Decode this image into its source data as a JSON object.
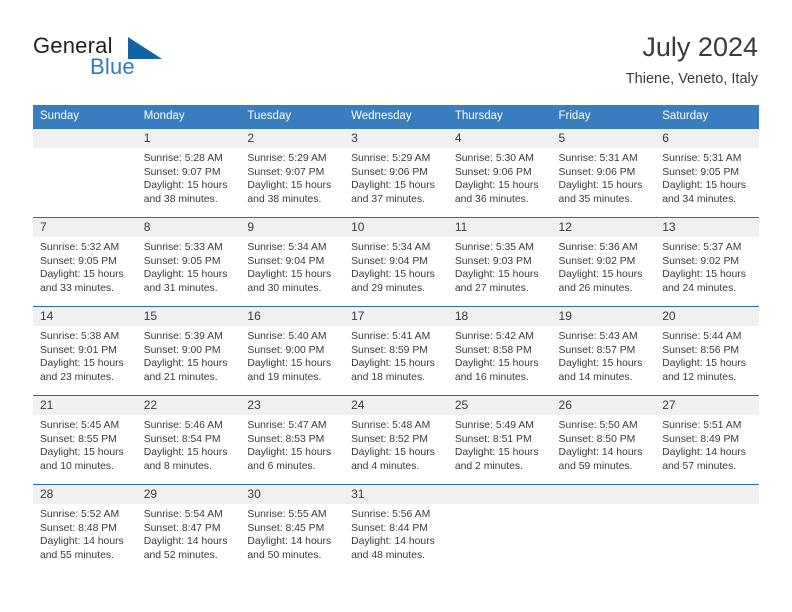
{
  "brand": {
    "word1": "General",
    "word2": "Blue",
    "mark": "triangle-logo"
  },
  "header": {
    "title": "July 2024",
    "subtitle": "Thiene, Veneto, Italy"
  },
  "colors": {
    "header_blue": "#3a7dbf",
    "rule_blue": "#2e6da4",
    "brand_blue": "#2b7cc2",
    "daynum_band": "#f0f0f0",
    "text": "#3b3b3b"
  },
  "weekday_headers": [
    "Sunday",
    "Monday",
    "Tuesday",
    "Wednesday",
    "Thursday",
    "Friday",
    "Saturday"
  ],
  "labels": {
    "sunrise": "Sunrise:",
    "sunset": "Sunset:",
    "daylight": "Daylight:"
  },
  "weeks": [
    [
      {
        "day": ""
      },
      {
        "day": "1",
        "sunrise": "Sunrise: 5:28 AM",
        "sunset": "Sunset: 9:07 PM",
        "daylight1": "Daylight: 15 hours",
        "daylight2": "and 38 minutes."
      },
      {
        "day": "2",
        "sunrise": "Sunrise: 5:29 AM",
        "sunset": "Sunset: 9:07 PM",
        "daylight1": "Daylight: 15 hours",
        "daylight2": "and 38 minutes."
      },
      {
        "day": "3",
        "sunrise": "Sunrise: 5:29 AM",
        "sunset": "Sunset: 9:06 PM",
        "daylight1": "Daylight: 15 hours",
        "daylight2": "and 37 minutes."
      },
      {
        "day": "4",
        "sunrise": "Sunrise: 5:30 AM",
        "sunset": "Sunset: 9:06 PM",
        "daylight1": "Daylight: 15 hours",
        "daylight2": "and 36 minutes."
      },
      {
        "day": "5",
        "sunrise": "Sunrise: 5:31 AM",
        "sunset": "Sunset: 9:06 PM",
        "daylight1": "Daylight: 15 hours",
        "daylight2": "and 35 minutes."
      },
      {
        "day": "6",
        "sunrise": "Sunrise: 5:31 AM",
        "sunset": "Sunset: 9:05 PM",
        "daylight1": "Daylight: 15 hours",
        "daylight2": "and 34 minutes."
      }
    ],
    [
      {
        "day": "7",
        "sunrise": "Sunrise: 5:32 AM",
        "sunset": "Sunset: 9:05 PM",
        "daylight1": "Daylight: 15 hours",
        "daylight2": "and 33 minutes."
      },
      {
        "day": "8",
        "sunrise": "Sunrise: 5:33 AM",
        "sunset": "Sunset: 9:05 PM",
        "daylight1": "Daylight: 15 hours",
        "daylight2": "and 31 minutes."
      },
      {
        "day": "9",
        "sunrise": "Sunrise: 5:34 AM",
        "sunset": "Sunset: 9:04 PM",
        "daylight1": "Daylight: 15 hours",
        "daylight2": "and 30 minutes."
      },
      {
        "day": "10",
        "sunrise": "Sunrise: 5:34 AM",
        "sunset": "Sunset: 9:04 PM",
        "daylight1": "Daylight: 15 hours",
        "daylight2": "and 29 minutes."
      },
      {
        "day": "11",
        "sunrise": "Sunrise: 5:35 AM",
        "sunset": "Sunset: 9:03 PM",
        "daylight1": "Daylight: 15 hours",
        "daylight2": "and 27 minutes."
      },
      {
        "day": "12",
        "sunrise": "Sunrise: 5:36 AM",
        "sunset": "Sunset: 9:02 PM",
        "daylight1": "Daylight: 15 hours",
        "daylight2": "and 26 minutes."
      },
      {
        "day": "13",
        "sunrise": "Sunrise: 5:37 AM",
        "sunset": "Sunset: 9:02 PM",
        "daylight1": "Daylight: 15 hours",
        "daylight2": "and 24 minutes."
      }
    ],
    [
      {
        "day": "14",
        "sunrise": "Sunrise: 5:38 AM",
        "sunset": "Sunset: 9:01 PM",
        "daylight1": "Daylight: 15 hours",
        "daylight2": "and 23 minutes."
      },
      {
        "day": "15",
        "sunrise": "Sunrise: 5:39 AM",
        "sunset": "Sunset: 9:00 PM",
        "daylight1": "Daylight: 15 hours",
        "daylight2": "and 21 minutes."
      },
      {
        "day": "16",
        "sunrise": "Sunrise: 5:40 AM",
        "sunset": "Sunset: 9:00 PM",
        "daylight1": "Daylight: 15 hours",
        "daylight2": "and 19 minutes."
      },
      {
        "day": "17",
        "sunrise": "Sunrise: 5:41 AM",
        "sunset": "Sunset: 8:59 PM",
        "daylight1": "Daylight: 15 hours",
        "daylight2": "and 18 minutes."
      },
      {
        "day": "18",
        "sunrise": "Sunrise: 5:42 AM",
        "sunset": "Sunset: 8:58 PM",
        "daylight1": "Daylight: 15 hours",
        "daylight2": "and 16 minutes."
      },
      {
        "day": "19",
        "sunrise": "Sunrise: 5:43 AM",
        "sunset": "Sunset: 8:57 PM",
        "daylight1": "Daylight: 15 hours",
        "daylight2": "and 14 minutes."
      },
      {
        "day": "20",
        "sunrise": "Sunrise: 5:44 AM",
        "sunset": "Sunset: 8:56 PM",
        "daylight1": "Daylight: 15 hours",
        "daylight2": "and 12 minutes."
      }
    ],
    [
      {
        "day": "21",
        "sunrise": "Sunrise: 5:45 AM",
        "sunset": "Sunset: 8:55 PM",
        "daylight1": "Daylight: 15 hours",
        "daylight2": "and 10 minutes."
      },
      {
        "day": "22",
        "sunrise": "Sunrise: 5:46 AM",
        "sunset": "Sunset: 8:54 PM",
        "daylight1": "Daylight: 15 hours",
        "daylight2": "and 8 minutes."
      },
      {
        "day": "23",
        "sunrise": "Sunrise: 5:47 AM",
        "sunset": "Sunset: 8:53 PM",
        "daylight1": "Daylight: 15 hours",
        "daylight2": "and 6 minutes."
      },
      {
        "day": "24",
        "sunrise": "Sunrise: 5:48 AM",
        "sunset": "Sunset: 8:52 PM",
        "daylight1": "Daylight: 15 hours",
        "daylight2": "and 4 minutes."
      },
      {
        "day": "25",
        "sunrise": "Sunrise: 5:49 AM",
        "sunset": "Sunset: 8:51 PM",
        "daylight1": "Daylight: 15 hours",
        "daylight2": "and 2 minutes."
      },
      {
        "day": "26",
        "sunrise": "Sunrise: 5:50 AM",
        "sunset": "Sunset: 8:50 PM",
        "daylight1": "Daylight: 14 hours",
        "daylight2": "and 59 minutes."
      },
      {
        "day": "27",
        "sunrise": "Sunrise: 5:51 AM",
        "sunset": "Sunset: 8:49 PM",
        "daylight1": "Daylight: 14 hours",
        "daylight2": "and 57 minutes."
      }
    ],
    [
      {
        "day": "28",
        "sunrise": "Sunrise: 5:52 AM",
        "sunset": "Sunset: 8:48 PM",
        "daylight1": "Daylight: 14 hours",
        "daylight2": "and 55 minutes."
      },
      {
        "day": "29",
        "sunrise": "Sunrise: 5:54 AM",
        "sunset": "Sunset: 8:47 PM",
        "daylight1": "Daylight: 14 hours",
        "daylight2": "and 52 minutes."
      },
      {
        "day": "30",
        "sunrise": "Sunrise: 5:55 AM",
        "sunset": "Sunset: 8:45 PM",
        "daylight1": "Daylight: 14 hours",
        "daylight2": "and 50 minutes."
      },
      {
        "day": "31",
        "sunrise": "Sunrise: 5:56 AM",
        "sunset": "Sunset: 8:44 PM",
        "daylight1": "Daylight: 14 hours",
        "daylight2": "and 48 minutes."
      },
      {
        "day": ""
      },
      {
        "day": ""
      },
      {
        "day": ""
      }
    ]
  ]
}
